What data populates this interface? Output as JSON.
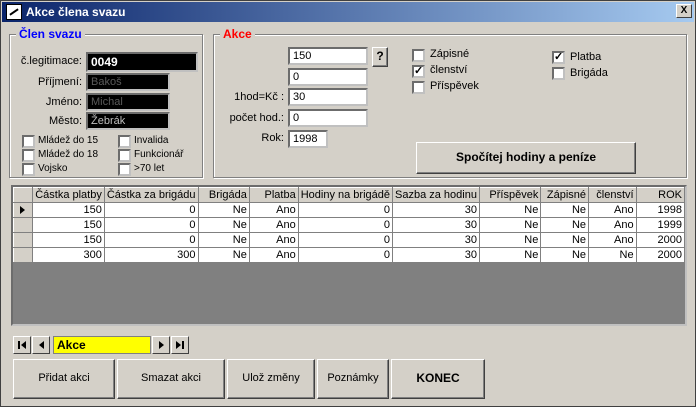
{
  "window": {
    "title": "Akce člena svazu",
    "close_label": "X"
  },
  "member": {
    "group_title": "Člen svazu",
    "id_label": "č.legitimace:",
    "id_value": "0049",
    "surname_label": "Příjmení:",
    "surname_value": "Bakoš",
    "name_label": "Jméno:",
    "name_value": "Michal",
    "city_label": "Město:",
    "city_value": "Žebrák",
    "flags": [
      {
        "label": "Mládež do 15",
        "checked": false
      },
      {
        "label": "Invalida",
        "checked": false
      },
      {
        "label": "Mládež do 18",
        "checked": false
      },
      {
        "label": "Funkcionář",
        "checked": false
      },
      {
        "label": "Vojsko",
        "checked": false
      },
      {
        "label": ">70 let",
        "checked": false
      }
    ]
  },
  "action": {
    "group_title": "Akce",
    "field1_value": "150",
    "help_label": "?",
    "field2_value": "0",
    "rate_label": "1hod=Kč :",
    "rate_value": "30",
    "hours_label": "počet hod.:",
    "hours_value": "0",
    "year_label": "Rok:",
    "year_value": "1998",
    "checks": [
      {
        "label": "Zápisné",
        "checked": false
      },
      {
        "label": "členství",
        "checked": true
      },
      {
        "label": "Příspěvek",
        "checked": false
      },
      {
        "label": "Platba",
        "checked": true
      },
      {
        "label": "Brigáda",
        "checked": false
      }
    ],
    "compute_button": "Spočítej hodiny a peníze"
  },
  "table": {
    "columns": [
      "Částka platby",
      "Částka za brigádu",
      "Brigáda",
      "Platba",
      "Hodiny na brigádě",
      "Sazba za hodinu",
      "Příspěvek",
      "Zápisné",
      "členství",
      "ROK"
    ],
    "rows": [
      [
        "150",
        "0",
        "Ne",
        "Ano",
        "0",
        "30",
        "Ne",
        "Ne",
        "Ano",
        "1998"
      ],
      [
        "150",
        "0",
        "Ne",
        "Ano",
        "0",
        "30",
        "Ne",
        "Ne",
        "Ano",
        "1999"
      ],
      [
        "150",
        "0",
        "Ne",
        "Ano",
        "0",
        "30",
        "Ne",
        "Ne",
        "Ano",
        "2000"
      ],
      [
        "300",
        "300",
        "Ne",
        "Ano",
        "0",
        "30",
        "Ne",
        "Ne",
        "Ne",
        "2000"
      ]
    ]
  },
  "navigator": {
    "record_label": "Akce"
  },
  "buttons": {
    "add": "Přidat akci",
    "delete": "Smazat akci",
    "save": "Ulož změny",
    "notes": "Poznámky",
    "end": "KONEC"
  },
  "colors": {
    "member_title": "#0000ff",
    "action_title": "#ff0000",
    "navigator_highlight": "#ffff00"
  }
}
